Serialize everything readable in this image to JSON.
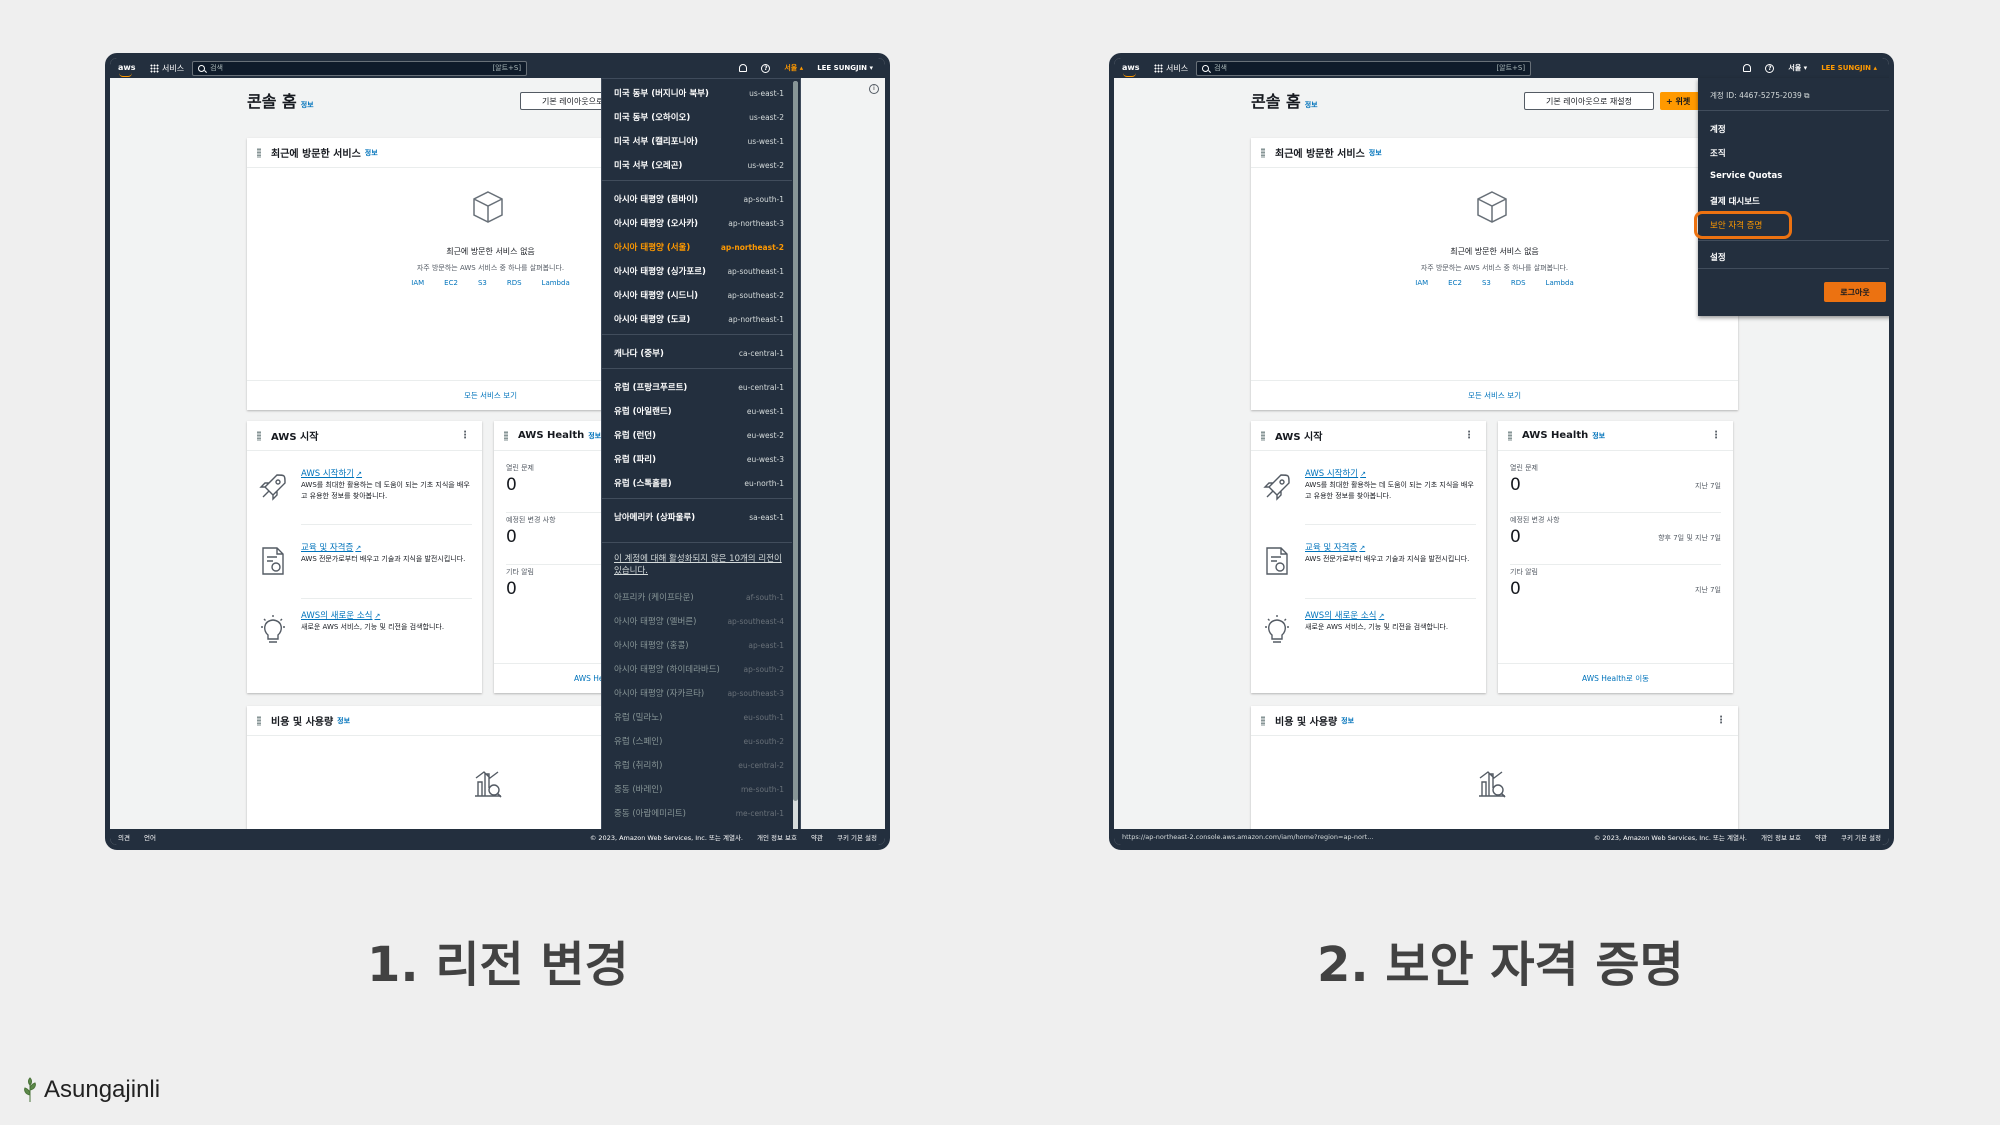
{
  "nav": {
    "logo": "aws",
    "services": "서비스",
    "search_placeholder": "검색",
    "search_shortcut": "[알트+S]",
    "region": "서울",
    "user": "LEE SUNGJIN"
  },
  "console": {
    "title": "콘솔 홈",
    "info": "정보",
    "reset_layout": "기본 레이아웃으로 재설정",
    "add_widget": "+ 위젯"
  },
  "recent": {
    "title": "최근에 방문한 서비스",
    "info": "정보",
    "empty_title": "최근에 방문한 서비스 없음",
    "empty_sub": "자주 방문하는 AWS 서비스 중 하나를 살펴봅니다.",
    "links": [
      "IAM",
      "EC2",
      "S3",
      "RDS",
      "Lambda"
    ],
    "view_all": "모든 서비스 보기"
  },
  "start": {
    "title": "AWS 시작",
    "items": [
      {
        "title": "AWS 시작하기",
        "desc": "AWS를 최대한 활용하는 데 도움이 되는 기초 지식을 배우고 유용한 정보를 찾아봅니다."
      },
      {
        "title": "교육 및 자격증",
        "desc": "AWS 전문가로부터 배우고 기술과 지식을 발전시킵니다."
      },
      {
        "title": "AWS의 새로운 소식",
        "desc": "새로운 AWS 서비스, 기능 및 리전을 검색합니다."
      }
    ]
  },
  "health": {
    "title": "AWS Health",
    "info": "정보",
    "rows": [
      {
        "label": "열린 문제",
        "value": "0",
        "range": "지난 7일"
      },
      {
        "label": "예정된 변경 사항",
        "value": "0",
        "range": "향후 7일 및 지난 7일"
      },
      {
        "label": "기타 알림",
        "value": "0",
        "range": "지난 7일"
      }
    ],
    "link": "AWS Health로 이동",
    "link_short": "AWS He"
  },
  "cost": {
    "title": "비용 및 사용량",
    "info": "정보"
  },
  "footer": {
    "feedback": "의견",
    "language": "언어",
    "url": "https://ap-northeast-2.console.aws.amazon.com/iam/home?region=ap-nort...",
    "copyright": "© 2023, Amazon Web Services, Inc. 또는 계열사.",
    "privacy": "개인 정보 보호",
    "terms": "약관",
    "cookies": "쿠키 기본 설정"
  },
  "regions": [
    {
      "name": "미국 동부 (버지니아 북부)",
      "code": "us-east-1"
    },
    {
      "name": "미국 동부 (오하이오)",
      "code": "us-east-2"
    },
    {
      "name": "미국 서부 (캘리포니아)",
      "code": "us-west-1"
    },
    {
      "name": "미국 서부 (오레곤)",
      "code": "us-west-2"
    },
    {
      "name": "아시아 태평양 (뭄바이)",
      "code": "ap-south-1"
    },
    {
      "name": "아시아 태평양 (오사카)",
      "code": "ap-northeast-3"
    },
    {
      "name": "아시아 태평양 (서울)",
      "code": "ap-northeast-2"
    },
    {
      "name": "아시아 태평양 (싱가포르)",
      "code": "ap-southeast-1"
    },
    {
      "name": "아시아 태평양 (시드니)",
      "code": "ap-southeast-2"
    },
    {
      "name": "아시아 태평양 (도쿄)",
      "code": "ap-northeast-1"
    },
    {
      "name": "캐나다 (중부)",
      "code": "ca-central-1"
    },
    {
      "name": "유럽 (프랑크푸르트)",
      "code": "eu-central-1"
    },
    {
      "name": "유럽 (아일랜드)",
      "code": "eu-west-1"
    },
    {
      "name": "유럽 (런던)",
      "code": "eu-west-2"
    },
    {
      "name": "유럽 (파리)",
      "code": "eu-west-3"
    },
    {
      "name": "유럽 (스톡홀름)",
      "code": "eu-north-1"
    },
    {
      "name": "남아메리카 (상파울루)",
      "code": "sa-east-1"
    }
  ],
  "regions_note": "이 계정에 대해 활성화되지 않은 10개의 리전이 있습니다.",
  "regions_disabled": [
    {
      "name": "아프리카 (케이프타운)",
      "code": "af-south-1"
    },
    {
      "name": "아시아 태평양 (멜버른)",
      "code": "ap-southeast-4"
    },
    {
      "name": "아시아 태평양 (홍콩)",
      "code": "ap-east-1"
    },
    {
      "name": "아시아 태평양 (하이데라바드)",
      "code": "ap-south-2"
    },
    {
      "name": "아시아 태평양 (자카르타)",
      "code": "ap-southeast-3"
    },
    {
      "name": "유럽 (밀라노)",
      "code": "eu-south-1"
    },
    {
      "name": "유럽 (스페인)",
      "code": "eu-south-2"
    },
    {
      "name": "유럽 (취리히)",
      "code": "eu-central-2"
    },
    {
      "name": "중동 (바레인)",
      "code": "me-south-1"
    },
    {
      "name": "중동 (아랍에미리트)",
      "code": "me-central-1"
    }
  ],
  "account_menu": {
    "account_id": "계정 ID: 4467-5275-2039",
    "items": [
      "계정",
      "조직",
      "Service Quotas",
      "결제 대시보드",
      "보안 자격 증명"
    ],
    "settings": "설정",
    "logout": "로그아웃"
  },
  "captions": [
    "1. 리전 변경",
    "2. 보안 자격 증명"
  ],
  "brand": "Asungajinli",
  "colors": {
    "nav": "#232f3e",
    "accent": "#ff9900",
    "link": "#0073bb",
    "highlight": "#ec7211"
  }
}
